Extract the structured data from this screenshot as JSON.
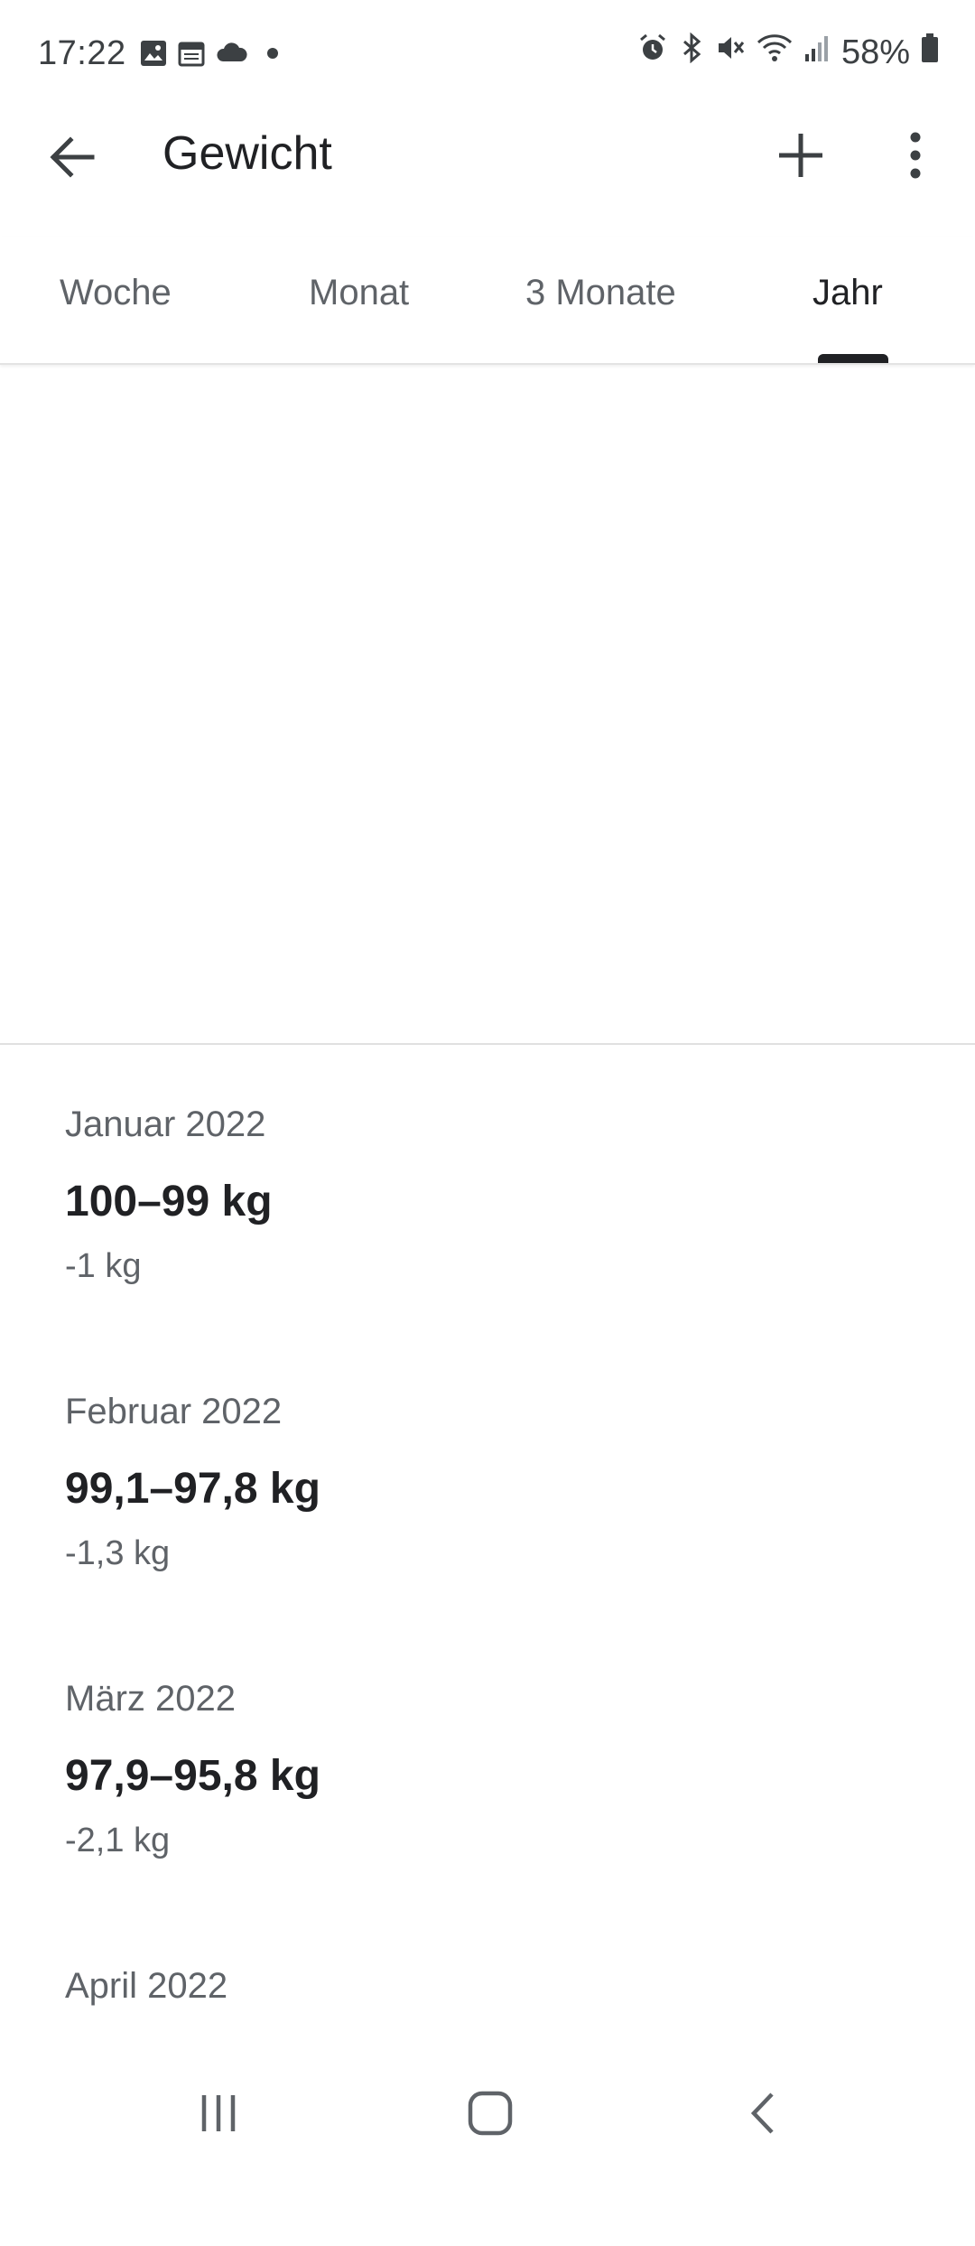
{
  "status_bar": {
    "time": "17:22",
    "battery": "58%",
    "left_icons": [
      "image-icon",
      "calendar-icon",
      "cloud-icon",
      "dot-icon"
    ],
    "right_icons": [
      "alarm-icon",
      "bluetooth-icon",
      "mute-icon",
      "wifi-icon",
      "signal-icon",
      "battery-icon"
    ]
  },
  "appbar": {
    "title": "Gewicht"
  },
  "tabs": [
    {
      "label": "Woche"
    },
    {
      "label": "Monat"
    },
    {
      "label": "3 Monate"
    },
    {
      "label": "Jahr",
      "active": true
    }
  ],
  "entries": [
    {
      "month": "Januar 2022",
      "range": "100–99 kg",
      "change": "-1 kg"
    },
    {
      "month": "Februar 2022",
      "range": "99,1–97,8 kg",
      "change": "-1,3 kg"
    },
    {
      "month": "März 2022",
      "range": "97,9–95,8 kg",
      "change": "-2,1 kg"
    },
    {
      "month": "April 2022"
    }
  ],
  "colors": {
    "text_primary": "#202124",
    "text_secondary": "#5f6368",
    "divider": "#e0e0e0"
  }
}
